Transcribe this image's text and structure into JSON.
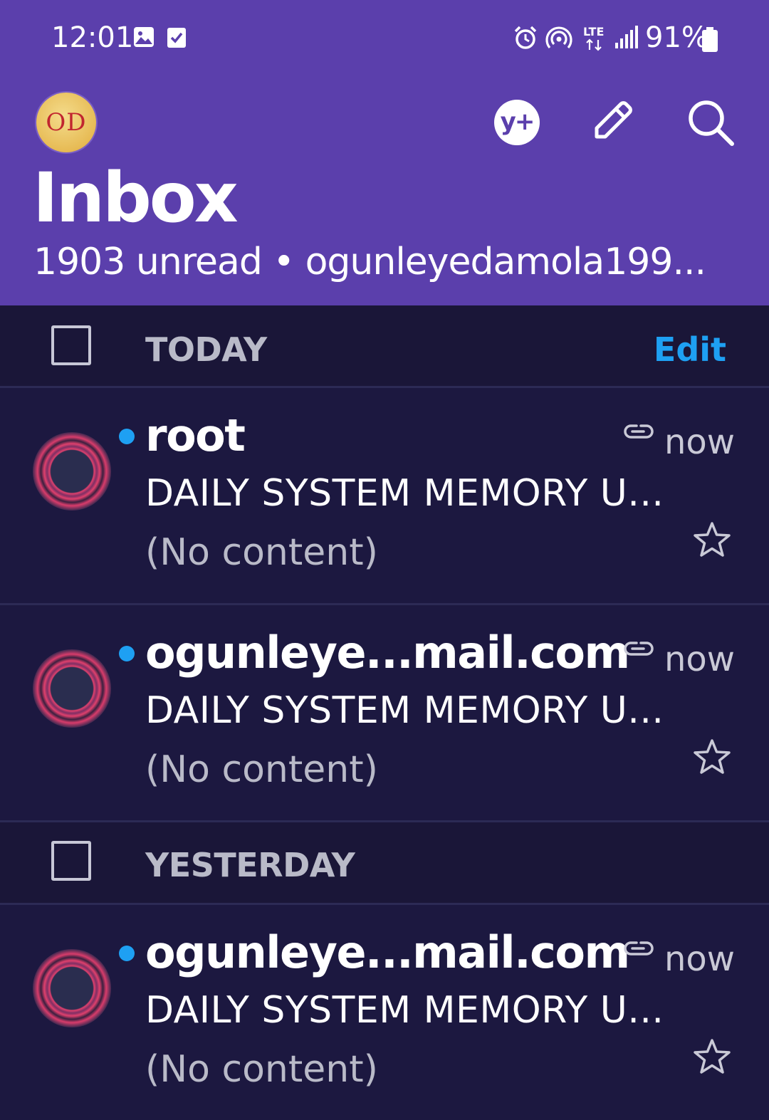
{
  "status_bar": {
    "time": "12:01",
    "network": "LTE",
    "battery": "91%",
    "icons": [
      "image-icon",
      "checkbox-notification-icon",
      "alarm-icon",
      "hotspot-icon",
      "lte-icon",
      "signal-icon",
      "battery-icon"
    ]
  },
  "header": {
    "avatar_initials": "OD",
    "title": "Inbox",
    "subtitle": "1903 unread • ogunleyedamola199...",
    "actions": [
      "yahoo-plus-icon",
      "compose-icon",
      "search-icon"
    ],
    "plus_label": "y+"
  },
  "sections": [
    {
      "label": "TODAY",
      "edit_label": "Edit",
      "emails": [
        {
          "sender": "root",
          "time": "now",
          "subject": "DAILY SYSTEM MEMORY U...",
          "preview": "(No content)",
          "unread": true,
          "has_attachment": true,
          "starred": false
        },
        {
          "sender": "ogunleye...mail.com",
          "time": "now",
          "subject": "DAILY SYSTEM MEMORY U...",
          "preview": "(No content)",
          "unread": true,
          "has_attachment": true,
          "starred": false
        }
      ]
    },
    {
      "label": "YESTERDAY",
      "emails": [
        {
          "sender": "ogunleye...mail.com",
          "time": "now",
          "subject": "DAILY SYSTEM MEMORY U...",
          "preview": "(No content)",
          "unread": true,
          "has_attachment": true,
          "starred": false
        }
      ]
    }
  ],
  "colors": {
    "header_bg": "#5b3fac",
    "list_bg": "#1c1840",
    "accent": "#1ea0f3"
  }
}
